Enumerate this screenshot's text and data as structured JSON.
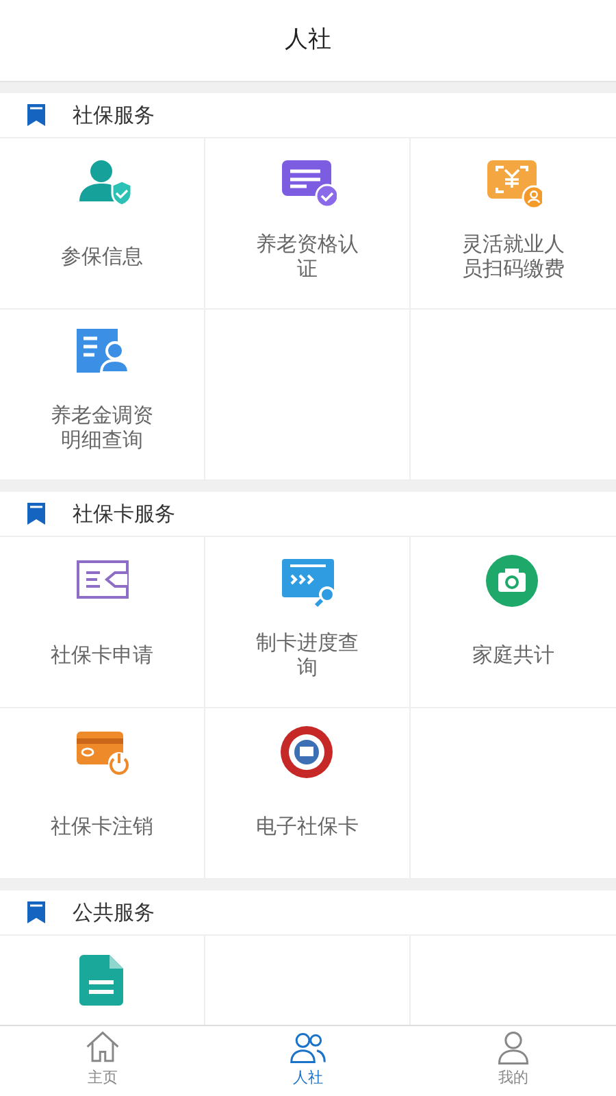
{
  "header": {
    "title": "人社"
  },
  "sections": [
    {
      "title": "社保服务",
      "items": [
        {
          "kind": "person-shield",
          "label": "参保信息"
        },
        {
          "kind": "card-check",
          "label": "养老资格认证"
        },
        {
          "kind": "scan-pay",
          "label": "灵活就业人员扫码缴费"
        },
        {
          "kind": "list-person",
          "label": "养老金调资明细查询"
        }
      ]
    },
    {
      "title": "社保卡服务",
      "items": [
        {
          "kind": "card-arrow",
          "label": "社保卡申请"
        },
        {
          "kind": "card-search",
          "label": "制卡进度查询"
        },
        {
          "kind": "camera",
          "label": "家庭共计"
        },
        {
          "kind": "card-power",
          "label": "社保卡注销"
        },
        {
          "kind": "seal",
          "label": "电子社保卡"
        }
      ]
    },
    {
      "title": "公共服务",
      "items": [
        {
          "kind": "document"
        }
      ]
    }
  ],
  "tabbar": [
    {
      "kind": "home",
      "label": "主页",
      "selected": false
    },
    {
      "kind": "people",
      "label": "人社",
      "selected": true
    },
    {
      "kind": "person",
      "label": "我的",
      "selected": false
    }
  ]
}
